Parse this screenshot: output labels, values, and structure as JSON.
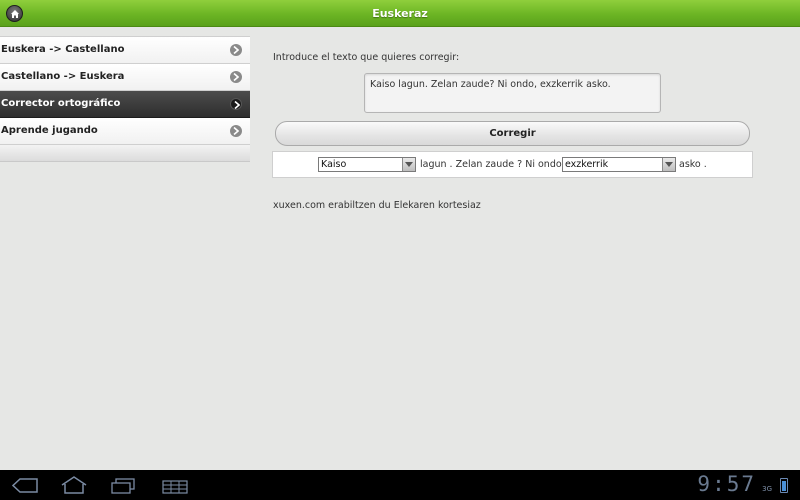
{
  "header": {
    "title": "Euskeraz",
    "home_icon": "home-icon"
  },
  "sidebar": {
    "items": [
      {
        "label": "Euskera -> Castellano",
        "active": false
      },
      {
        "label": "Castellano -> Euskera",
        "active": false
      },
      {
        "label": "Corrector ortográfico",
        "active": true
      },
      {
        "label": "Aprende jugando",
        "active": false
      }
    ]
  },
  "main": {
    "intro_label": "Introduce el texto que quieres corregir:",
    "input_text": "Kaiso lagun. Zelan zaude? Ni ondo, exzkerrik asko.",
    "correct_button": "Corregir",
    "result": {
      "select1_value": "Kaiso",
      "segment1": "lagun . Zelan zaude ? Ni ondo ,",
      "select2_value": "exzkerrik",
      "segment2": "asko ."
    },
    "credit": "xuxen.com erabiltzen du Elekaren kortesiaz"
  },
  "system_bar": {
    "clock": "9:57",
    "network": "3G",
    "icons": [
      "back-icon",
      "home-icon",
      "recent-apps-icon",
      "menu-icon"
    ],
    "accent_color": "#6a7a90"
  },
  "colors": {
    "header_green": "#6cb524",
    "active_item": "#333333",
    "background": "#e6e7e5"
  }
}
